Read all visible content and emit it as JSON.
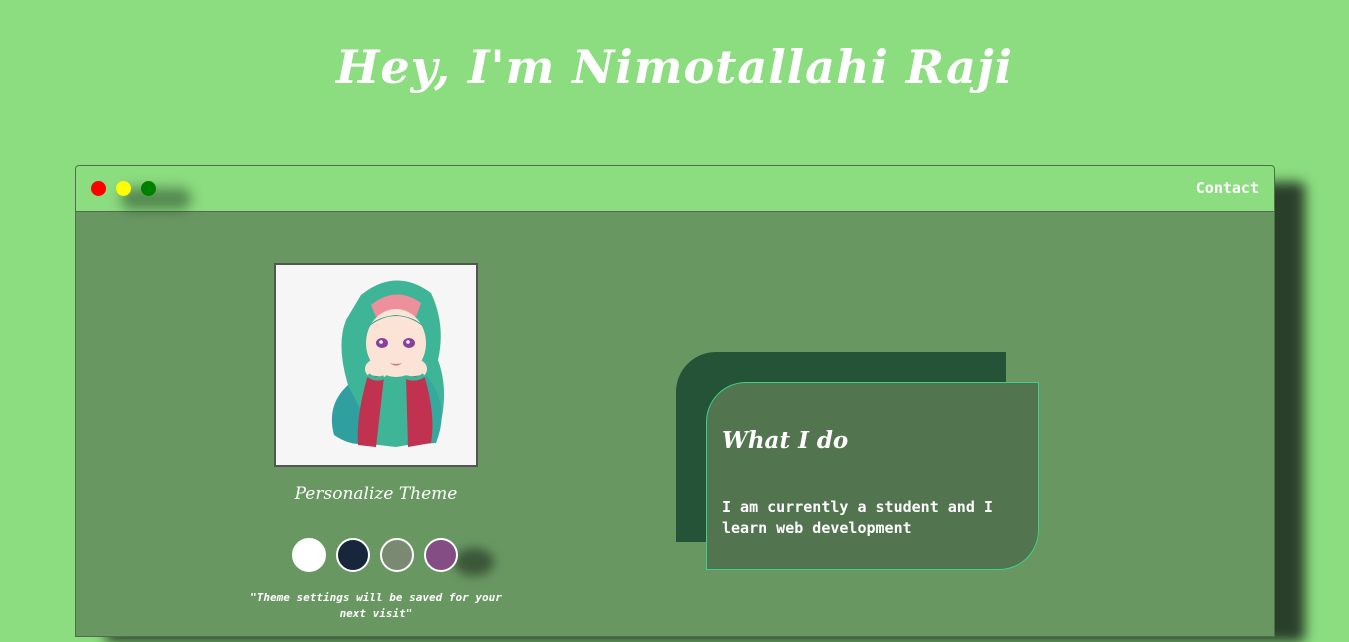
{
  "header": {
    "title": "Hey, I'm Nimotallahi Raji"
  },
  "browser": {
    "nav": {
      "contact_label": "Contact"
    },
    "window_controls": [
      "close",
      "minimize",
      "maximize"
    ]
  },
  "profile": {
    "avatar_icon": "hijab-girl-illustration"
  },
  "theme": {
    "title": "Personalize Theme",
    "options": [
      {
        "name": "white",
        "color": "#ffffff"
      },
      {
        "name": "navy",
        "color": "#17263a"
      },
      {
        "name": "sage",
        "color": "#7a8a72"
      },
      {
        "name": "plum",
        "color": "#844d83"
      }
    ],
    "note": "\"Theme settings will be saved for your next visit\""
  },
  "about": {
    "title": "What I do",
    "text": "I am currently a student and I learn web development"
  },
  "colors": {
    "page_background": "#8cdc80",
    "window_body": "#699762",
    "card_back": "#245338",
    "card_front": "#52744f",
    "card_border": "#3ad28c"
  }
}
